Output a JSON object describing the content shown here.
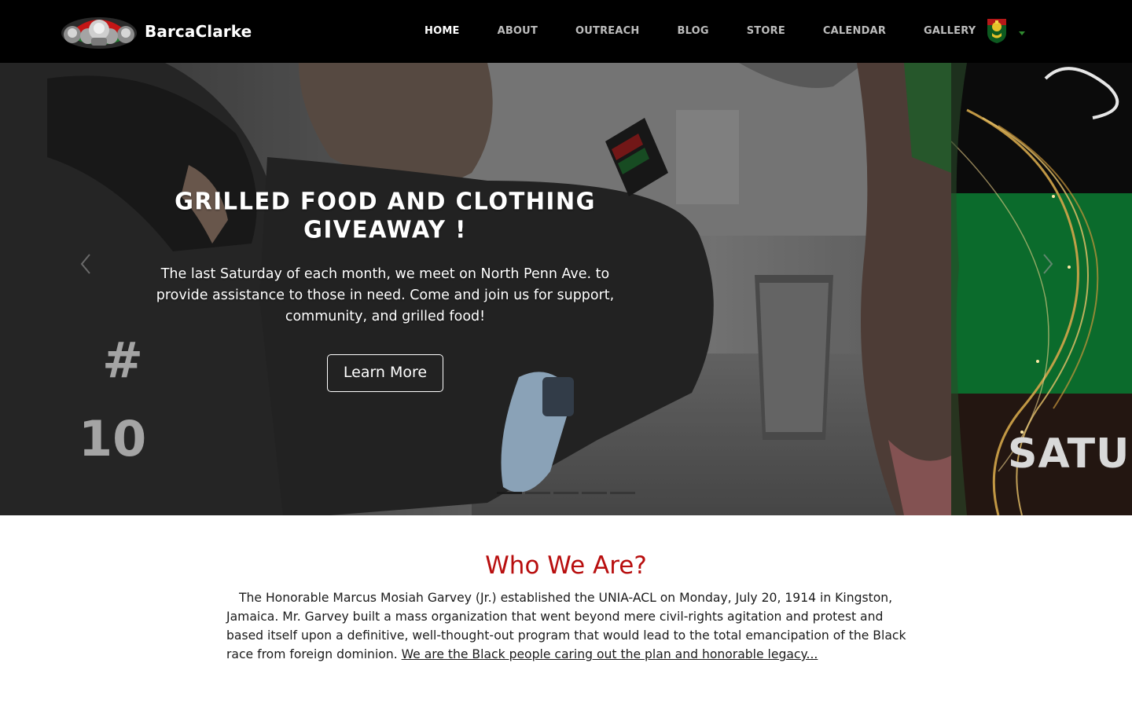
{
  "brand": {
    "name": "BarcaClarke",
    "logo_icon": "portraits-logo-icon"
  },
  "nav": {
    "items": [
      {
        "label": "HOME",
        "active": true
      },
      {
        "label": "ABOUT",
        "active": false
      },
      {
        "label": "OUTREACH",
        "active": false
      },
      {
        "label": "BLOG",
        "active": false
      },
      {
        "label": "STORE",
        "active": false
      },
      {
        "label": "CALENDAR",
        "active": false
      },
      {
        "label": "GALLERY",
        "active": false
      }
    ],
    "badge_icon": "unia-emblem-icon",
    "dropdown_icon": "caret-down-icon"
  },
  "hero": {
    "title": "Grilled Food and Clothing Giveaway !",
    "text": "The last Saturday of each month, we meet on North Penn Ave. to provide assistance to those in need. Come and join us for support, community, and grilled food!",
    "button_label": "Learn More",
    "next_slide_text": "SATUR",
    "slide_count": 5,
    "active_slide": 1,
    "prev_icon": "chevron-left-icon",
    "next_icon": "chevron-right-icon"
  },
  "about": {
    "title": "Who We Are?",
    "text": "The Honorable Marcus Mosiah Garvey (Jr.) established the UNIA-ACL on Monday, July 20, 1914 in Kingston, Jamaica. Mr. Garvey built a mass organization that went beyond mere civil-rights agitation and protest and based itself upon a definitive, well-thought-out program that would lead to the total emancipation of the Black race from foreign dominion.",
    "link_label": "We are the Black people caring out the plan and honorable legacy..."
  },
  "colors": {
    "nav_bg": "#000000",
    "accent_red": "#b80e0e",
    "caret_green": "#2f8a2f",
    "slide_green": "#0b6b2c"
  }
}
